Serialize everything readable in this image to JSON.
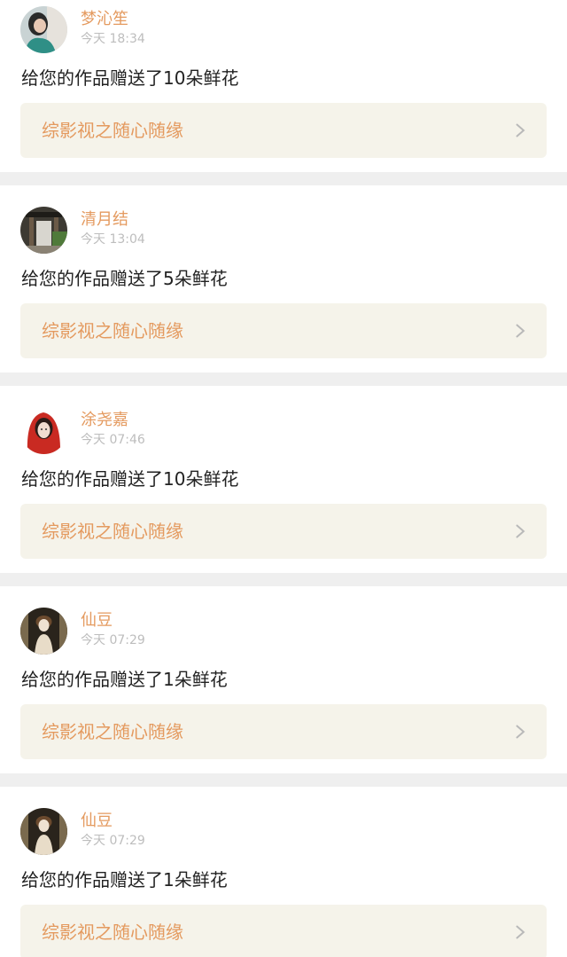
{
  "feed": {
    "items": [
      {
        "username": "梦沁笙",
        "time": "今天 18:34",
        "message": "给您的作品赠送了10朵鲜花",
        "work_title": "综影视之随心随缘",
        "avatar_icon": "avatar-girl-teal-icon"
      },
      {
        "username": "清月结",
        "time": "今天 13:04",
        "message": "给您的作品赠送了5朵鲜花",
        "work_title": "综影视之随心随缘",
        "avatar_icon": "avatar-gate-scene-icon"
      },
      {
        "username": "涂尧嘉",
        "time": "今天 07:46",
        "message": "给您的作品赠送了10朵鲜花",
        "work_title": "综影视之随心随缘",
        "avatar_icon": "avatar-red-hood-icon"
      },
      {
        "username": "仙豆",
        "time": "今天 07:29",
        "message": "给您的作品赠送了1朵鲜花",
        "work_title": "综影视之随心随缘",
        "avatar_icon": "avatar-doll-icon"
      },
      {
        "username": "仙豆",
        "time": "今天 07:29",
        "message": "给您的作品赠送了1朵鲜花",
        "work_title": "综影视之随心随缘",
        "avatar_icon": "avatar-doll-icon"
      }
    ]
  },
  "colors": {
    "accent": "#e49a5f",
    "link_background": "#f5f3ea",
    "separator": "#efefef",
    "timestamp": "#bdbdbd"
  }
}
